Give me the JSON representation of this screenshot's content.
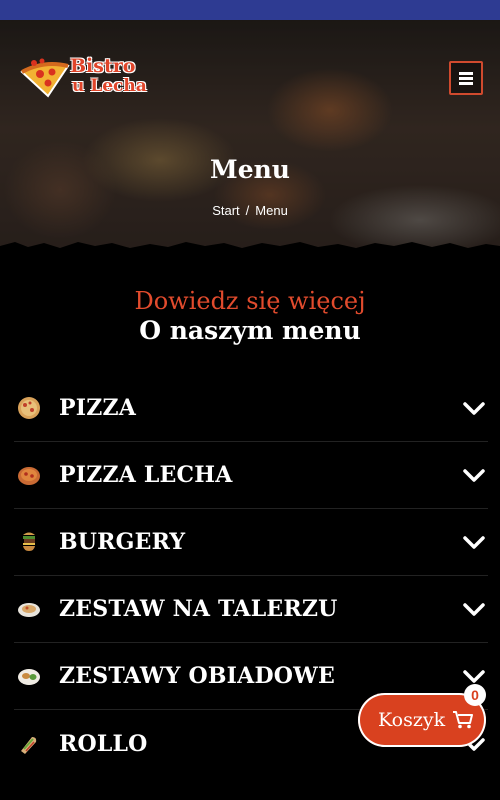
{
  "header": {
    "logo": {
      "line1": "Bistro",
      "line2": "u Lecha"
    },
    "menu_icon": "hamburger-icon"
  },
  "hero": {
    "title": "Menu",
    "breadcrumb": {
      "home": "Start",
      "separator": "/",
      "current": "Menu"
    }
  },
  "section": {
    "subtitle": "Dowiedz się więcej",
    "title": "O naszym menu"
  },
  "menu_items": [
    {
      "label": "PIZZA",
      "icon": "pizza-icon"
    },
    {
      "label": "PIZZA LECHA",
      "icon": "pizza-lecha-icon"
    },
    {
      "label": "BURGERY",
      "icon": "burger-icon"
    },
    {
      "label": "ZESTAW NA TALERZU",
      "icon": "plate-icon"
    },
    {
      "label": "ZESTAWY OBIADOWE",
      "icon": "dinner-icon"
    },
    {
      "label": "ROLLO",
      "icon": "rollo-icon"
    }
  ],
  "cart": {
    "label": "Koszyk",
    "count": "0",
    "icon": "cart-icon"
  },
  "colors": {
    "accent": "#e14b2d",
    "top_strip": "#2e3b92",
    "background": "#000000"
  }
}
